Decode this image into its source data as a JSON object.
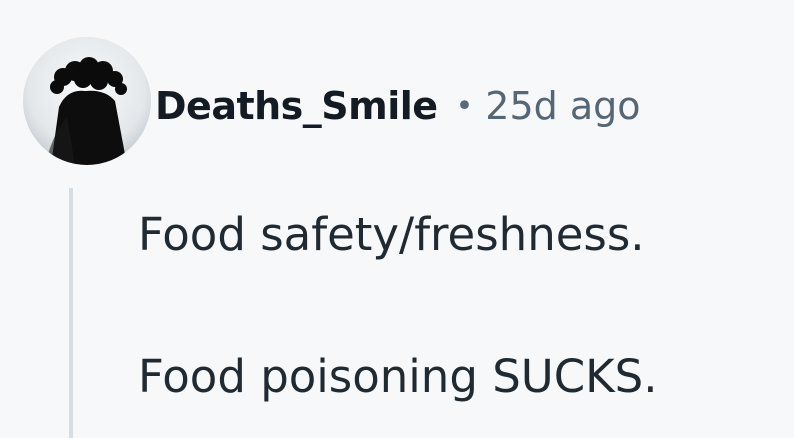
{
  "comment": {
    "author": "Deaths_Smile",
    "separator": "•",
    "timestamp": "25d ago",
    "body_lines": [
      "Food safety/freshness.",
      "Food poisoning SUCKS."
    ]
  },
  "icons": {
    "avatar": "user-avatar-icon"
  },
  "colors": {
    "background": "#f6f8fa",
    "author_text": "#141b22",
    "meta_text": "#566675",
    "body_text": "#222a31",
    "thread_line": "#d5dde5"
  }
}
